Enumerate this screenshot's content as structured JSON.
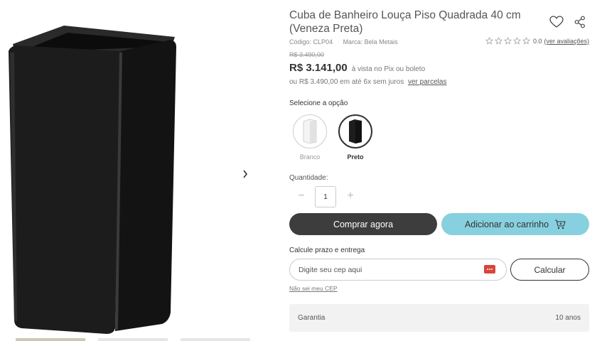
{
  "product": {
    "title": "Cuba de Banheiro Louça Piso Quadrada 40 cm (Veneza Preta)",
    "code": "Código: CLP04",
    "brand": "Marca: Bela Metais",
    "image_icon": "black-square-washbasin-image"
  },
  "rating": {
    "stars_total": 5,
    "stars_filled": 0,
    "value": "0.0",
    "link_label": "(ver avaliações)"
  },
  "price": {
    "old": "R$ 3.490,00",
    "current": "R$ 3.141,00",
    "note": "à vista no Pix ou boleto",
    "installments_text": "ou R$ 3.490,00 em até 6x sem juros",
    "installments_link": "ver parcelas"
  },
  "options": {
    "label": "Selecione a opção",
    "items": [
      {
        "name": "Branco",
        "selected": false,
        "color": "#ffffff"
      },
      {
        "name": "Preto",
        "selected": true,
        "color": "#1a1a1a"
      }
    ]
  },
  "quantity": {
    "label": "Quantidade:",
    "value": "1",
    "minus": "−",
    "plus": "+"
  },
  "buttons": {
    "buy": "Comprar agora",
    "cart": "Adicionar ao carrinho"
  },
  "shipping": {
    "label": "Calcule prazo e entrega",
    "placeholder": "Digite seu cep aqui",
    "calculate": "Calcular",
    "unknown_cep": "Não sei meu CEP"
  },
  "warranty": {
    "label": "Garantia",
    "value": "10 anos"
  },
  "colors": {
    "buy_button": "#3d3d3d",
    "cart_button": "#87d0df",
    "cep_icon": "#d9443a"
  }
}
